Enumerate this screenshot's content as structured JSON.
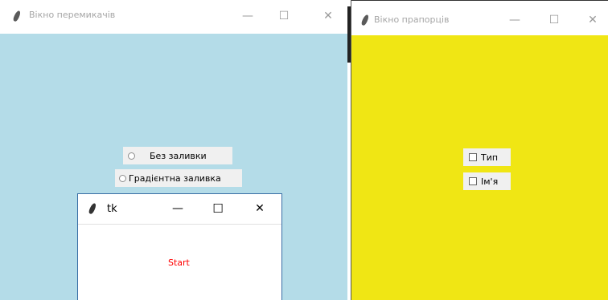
{
  "radio_window": {
    "title": "Вікно перемикачів",
    "bg_color": "#b4dce8",
    "options": [
      "Без заливки",
      "Градієнтна заливка"
    ]
  },
  "check_window": {
    "title": "Вікно прапорців",
    "bg_color": "#f0e614",
    "options": [
      "Тип",
      "Ім'я"
    ]
  },
  "tk_window": {
    "title": "tk",
    "label": "Start",
    "label_color": "#ff0000"
  },
  "controls": {
    "minimize": "—",
    "maximize": "☐",
    "close": "✕"
  },
  "icons": [
    "feather-icon",
    "minimize-icon",
    "maximize-icon",
    "close-icon",
    "radio-icon",
    "checkbox-icon"
  ]
}
